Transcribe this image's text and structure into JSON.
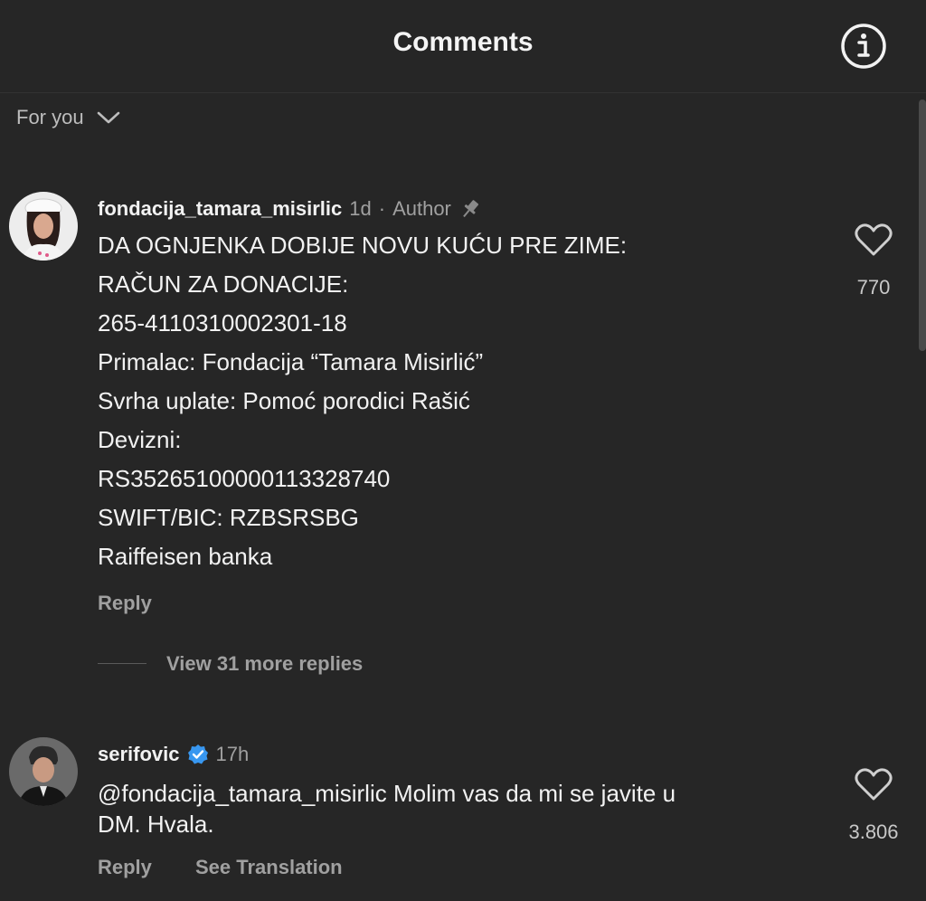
{
  "header": {
    "title": "Comments",
    "info_icon": "info-circle-icon"
  },
  "sort": {
    "label": "For you",
    "icon": "chevron-down-icon"
  },
  "comments": [
    {
      "username": "fondacija_tamara_misirlic",
      "time": "1d",
      "separator": "·",
      "badge": "Author",
      "pin_icon": "pin-icon",
      "lines": [
        "DA OGNJENKA DOBIJE NOVU KUĆU PRE ZIME:",
        "RAČUN ZA DONACIJE:",
        "265-4110310002301-18",
        "Primalac: Fondacija “Tamara Misirlić”",
        "Svrha uplate: Pomoć porodici Rašić",
        "Devizni:",
        "RS35265100000113328740",
        "SWIFT/BIC: RZBSRSBG",
        "Raiffeisen banka"
      ],
      "reply_label": "Reply",
      "likes": "770",
      "view_replies": "View 31 more replies"
    },
    {
      "username": "serifovic",
      "verified_icon": "verified-badge-icon",
      "time": "17h",
      "lines": [
        "@fondacija_tamara_misirlic Molim vas da mi se javite u",
        "DM. Hvala."
      ],
      "reply_label": "Reply",
      "translate_label": "See Translation",
      "likes": "3.806"
    }
  ],
  "colors": {
    "background": "#262626",
    "text": "#f2f2f2",
    "muted": "#a0a0a0",
    "verified": "#3897f0"
  }
}
